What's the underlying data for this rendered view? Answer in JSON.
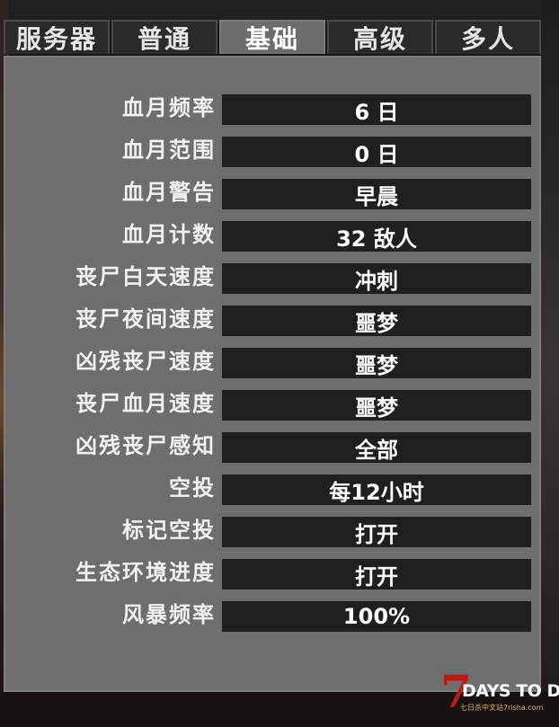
{
  "tabs": [
    {
      "label": "服务器",
      "active": false
    },
    {
      "label": "普通",
      "active": false
    },
    {
      "label": "基础",
      "active": true
    },
    {
      "label": "高级",
      "active": false
    },
    {
      "label": "多人",
      "active": false
    }
  ],
  "settings": [
    {
      "label": "血月频率",
      "value": "6 日"
    },
    {
      "label": "血月范围",
      "value": "0 日"
    },
    {
      "label": "血月警告",
      "value": "早晨"
    },
    {
      "label": "血月计数",
      "value": "32 敌人"
    },
    {
      "label": "丧尸白天速度",
      "value": "冲刺"
    },
    {
      "label": "丧尸夜间速度",
      "value": "噩梦"
    },
    {
      "label": "凶残丧尸速度",
      "value": "噩梦"
    },
    {
      "label": "丧尸血月速度",
      "value": "噩梦"
    },
    {
      "label": "凶残丧尸感知",
      "value": "全部"
    },
    {
      "label": "空投",
      "value": "每12小时"
    },
    {
      "label": "标记空投",
      "value": "打开"
    },
    {
      "label": "生态环境进度",
      "value": "打开"
    },
    {
      "label": "风暴频率",
      "value": "100%"
    }
  ],
  "logo": {
    "mark": "7",
    "text": "DAYS TO DIE",
    "subtitle": "七日杀中文站7risha.com"
  },
  "colors": {
    "panel": "#6e6e6e",
    "active_tab": "#6d6d6d",
    "inactive_tab": "#2a2a2a",
    "value_field": "#1f1f1f",
    "logo_red": "#c01818"
  }
}
